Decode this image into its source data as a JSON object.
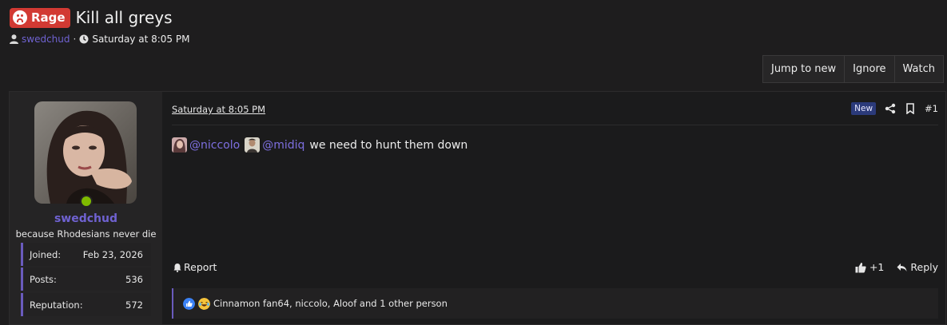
{
  "thread": {
    "prefix": "Rage",
    "title": "Kill all greys",
    "author": "swedchud",
    "separator": "·",
    "date": "Saturday at 8:05 PM"
  },
  "toolbar": {
    "jump_label": "Jump to new",
    "ignore_label": "Ignore",
    "watch_label": "Watch"
  },
  "post": {
    "date": "Saturday at 8:05 PM",
    "new_badge": "New",
    "number": "#1",
    "author": {
      "name": "swedchud",
      "title": "because Rhodesians never die",
      "stats": [
        {
          "label": "Joined:",
          "value": "Feb 23, 2026"
        },
        {
          "label": "Posts:",
          "value": "536"
        },
        {
          "label": "Reputation:",
          "value": "572"
        }
      ],
      "online_color": "#7fba00"
    },
    "message": {
      "mention1": "@niccolo",
      "mention2": "@midiq",
      "text": "we need to hunt them down"
    },
    "report_label": "Report",
    "like_label": "+1",
    "reply_label": "Reply",
    "reactions_text": "Cinnamon fan64, niccolo, Aloof and 1 other person"
  },
  "colors": {
    "accent": "#6f62d1",
    "rage_badge": "#d23a33",
    "background": "#1e1d1e"
  }
}
